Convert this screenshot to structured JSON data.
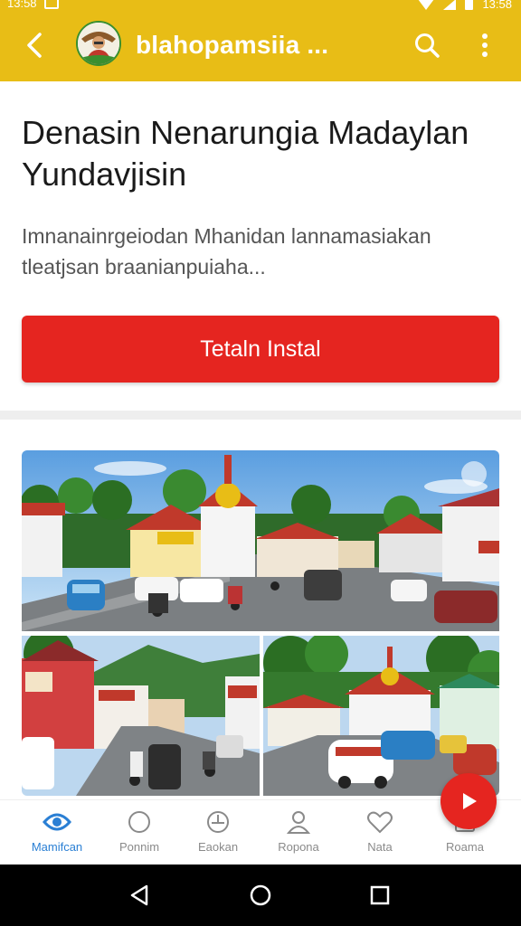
{
  "status_bar": {
    "time_left": "13:58",
    "time_right": "13:58"
  },
  "app_bar": {
    "title": "blahopamsiia ..."
  },
  "article": {
    "headline": "Denasin Nenarungia Madaylan Yundavjisin",
    "description": "Imnanainrgeiodan Mhanidan lannamasiakan tleatjsan braanianpuiaha..."
  },
  "install_button": {
    "label": "Tetaln Instal"
  },
  "bottom_nav": {
    "items": [
      {
        "label": "Mamifcan",
        "icon": "home-icon",
        "active": true
      },
      {
        "label": "Ponnim",
        "icon": "circle-icon",
        "active": false
      },
      {
        "label": "Eaokan",
        "icon": "compass-icon",
        "active": false
      },
      {
        "label": "Ropona",
        "icon": "profile-icon",
        "active": false
      },
      {
        "label": "Nata",
        "icon": "heart-icon",
        "active": false
      },
      {
        "label": "Roama",
        "icon": "tray-icon",
        "active": false
      }
    ]
  },
  "colors": {
    "appbar": "#e8bd16",
    "accent_red": "#e52520",
    "active_blue": "#2a7fd4"
  }
}
